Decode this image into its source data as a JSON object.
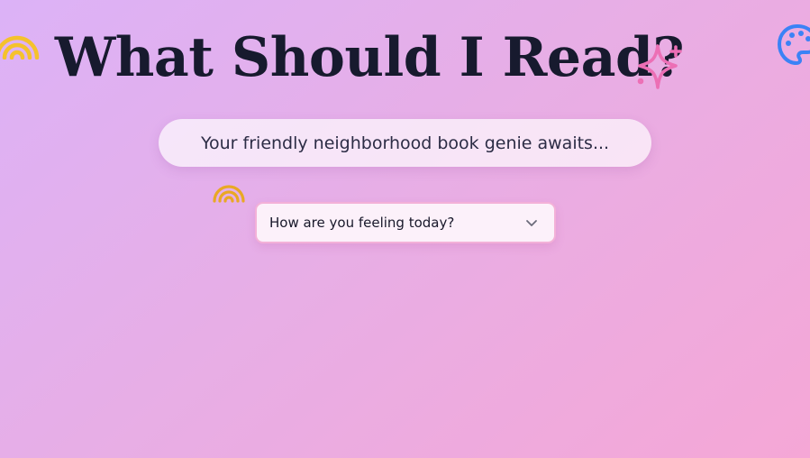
{
  "header": {
    "title": "What Should I Read?",
    "subtitle": "Your friendly neighborhood book genie awaits..."
  },
  "mood_select": {
    "placeholder": "How are you feeling today?",
    "icon": "chevron-down-icon"
  },
  "decorations": [
    {
      "name": "rainbow-icon",
      "color": "#f5c22c"
    },
    {
      "name": "rainbow-icon",
      "color": "#e9a824"
    },
    {
      "name": "sparkle-icon",
      "color": "#ec6fb5"
    },
    {
      "name": "palette-icon",
      "color": "#3b82f6"
    }
  ],
  "colors": {
    "background_start": "#dcb2f7",
    "background_end": "#f5a7d6",
    "title": "#171a2e",
    "select_border": "#f3b1d8"
  }
}
